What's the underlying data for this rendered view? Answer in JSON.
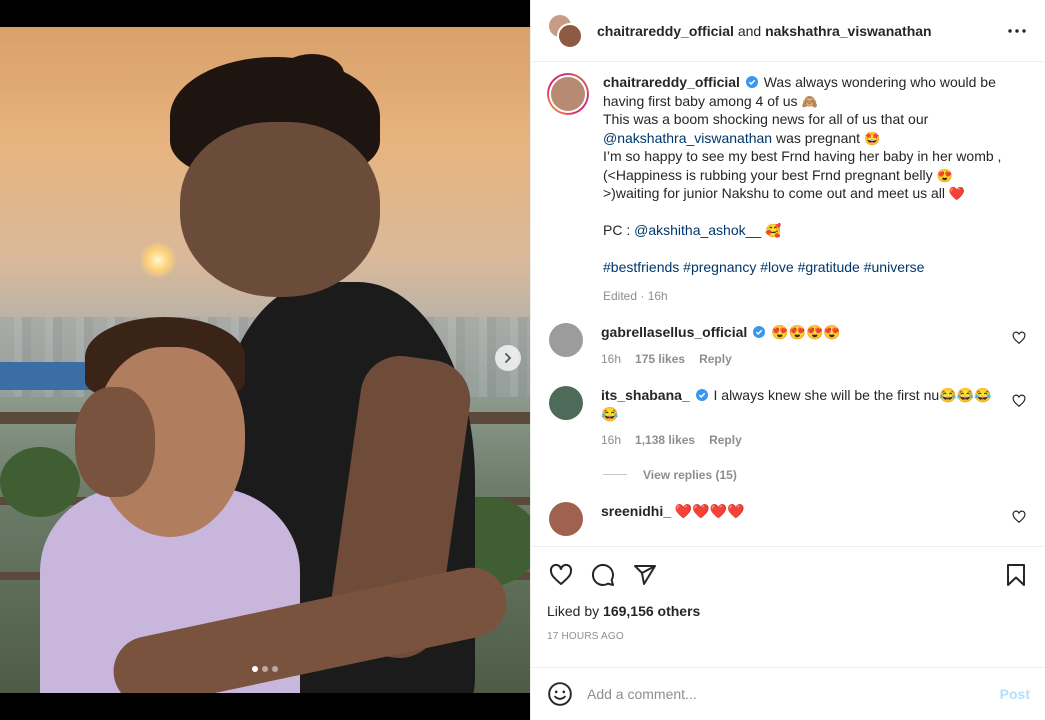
{
  "header": {
    "user1": "chaitrareddy_official",
    "conjunction": "and",
    "user2": "nakshathra_viswanathan"
  },
  "caption": {
    "username": "chaitrareddy_official",
    "line1": "Was always wondering who would be having first baby among 4 of us",
    "line1_emoji": "🙈",
    "line2": "This was a boom shocking news for all of us that our",
    "mention": "@nakshathra_viswanathan",
    "line3": "was pregnant",
    "line3_emoji": "🤩",
    "line4": "I’m so happy to see my best Frnd having her baby in her womb , (<Happiness is rubbing your best Frnd pregnant belly",
    "line4_emoji": "😍",
    "line5": ">)waiting for junior Nakshu to come out and meet us all",
    "line5_emoji": "❤️",
    "pc_label": "PC :",
    "pc_mention": "@akshitha_ashok__",
    "pc_emoji": "🥰",
    "hashtags": "#bestfriends #pregnancy #love #gratitude #universe",
    "edited": "Edited · 16h"
  },
  "comments": [
    {
      "username": "gabrellasellus_official",
      "verified": true,
      "text": "😍😍😍😍",
      "time": "16h",
      "likes": "175 likes",
      "reply": "Reply",
      "avatar_color": "#9c9c9c"
    },
    {
      "username": "its_shabana_",
      "verified": true,
      "text": "I always knew she will be the first nu😂😂😂😂",
      "time": "16h",
      "likes": "1,138 likes",
      "reply": "Reply",
      "avatar_color": "#4d6b58"
    },
    {
      "username": "sreenidhi_",
      "verified": false,
      "text": "❤️❤️❤️❤️",
      "time": "",
      "likes": "",
      "reply": "",
      "avatar_color": "#a0614f"
    }
  ],
  "view_replies": "View replies (15)",
  "likes": {
    "prefix": "Liked by",
    "count": "169,156 others"
  },
  "timestamp": "17 HOURS AGO",
  "add_comment": {
    "placeholder": "Add a comment...",
    "post_label": "Post"
  },
  "colors": {
    "verified": "#3897f0",
    "link": "#00376b",
    "post_disabled": "#b2dffc"
  },
  "carousel": {
    "slides": 3,
    "active": 1
  },
  "icons": {
    "more": "more-icon",
    "like": "heart-icon",
    "comment": "comment-icon",
    "share": "share-icon",
    "save": "bookmark-icon",
    "emoji": "emoji-icon",
    "next": "chevron-right-icon"
  }
}
